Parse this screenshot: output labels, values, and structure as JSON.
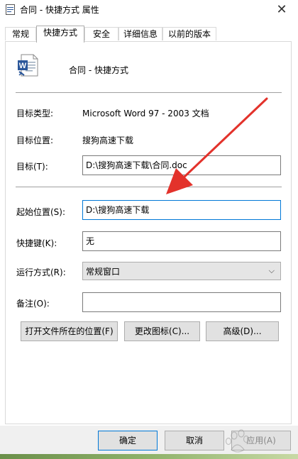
{
  "window": {
    "title": "合同 - 快捷方式 属性"
  },
  "tabs": [
    {
      "label": "常规"
    },
    {
      "label": "快捷方式"
    },
    {
      "label": "安全"
    },
    {
      "label": "详细信息"
    },
    {
      "label": "以前的版本"
    }
  ],
  "shortcut": {
    "name": "合同 - 快捷方式",
    "target_type_label": "目标类型:",
    "target_type_value": "Microsoft Word 97 - 2003 文档",
    "target_location_label": "目标位置:",
    "target_location_value": "搜狗高速下载",
    "target_label": "目标(T):",
    "target_value": "D:\\搜狗高速下载\\合同.doc",
    "start_in_label": "起始位置(S):",
    "start_in_value": "D:\\搜狗高速下载",
    "hotkey_label": "快捷键(K):",
    "hotkey_value": "无",
    "run_label": "运行方式(R):",
    "run_value": "常规窗口",
    "comment_label": "备注(O):",
    "comment_value": ""
  },
  "buttons": {
    "open_location": "打开文件所在的位置(F)",
    "change_icon": "更改图标(C)...",
    "advanced": "高级(D)...",
    "ok": "确定",
    "cancel": "取消",
    "apply": "应用(A)"
  },
  "colors": {
    "accent": "#0078d7",
    "arrow": "#e3322b"
  },
  "icons": {
    "title": "word-document-icon",
    "file": "word-document-icon"
  }
}
